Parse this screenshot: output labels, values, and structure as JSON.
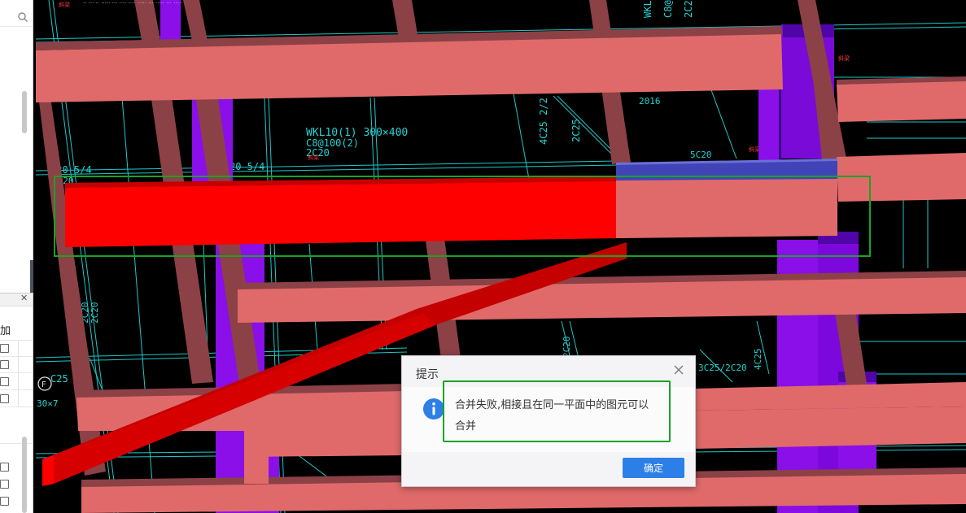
{
  "dialog": {
    "title": "提示",
    "message_line1": "合并失败,相接且在同一平面中的图元可以",
    "message_line2": "合并",
    "ok_label": "确定",
    "close_icon": "close-icon",
    "info_icon": "info-icon"
  },
  "left_panel": {
    "label": "加",
    "close_glyph": "✕",
    "search_icon": "search-icon"
  },
  "viewport": {
    "caption": "·· ··· ·· ····· ··· ···· ···· ····· ··· ····· ··· ·····",
    "cad_labels": [
      "WKL10(1) 300×400",
      "C8@100(2)",
      "2C20",
      "C20 5/4",
      "20 5/4",
      "2C20",
      "2016",
      "2C25",
      "C25 4/2",
      "3C25/2C20",
      "4C25",
      "30×7",
      "斜梁"
    ]
  },
  "colors": {
    "beam": "#e06a6a",
    "beam_dark": "#8c4146",
    "selected": "#ff0000",
    "column": "#8a0fe8",
    "cad_line": "#1fc8c8",
    "highlight": "#19a326",
    "button": "#2d7fe8"
  }
}
